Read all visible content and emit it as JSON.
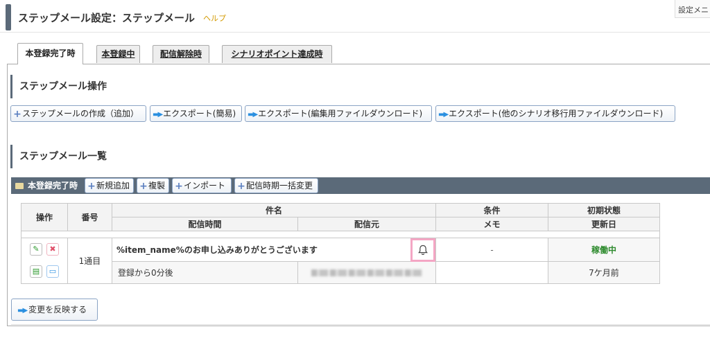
{
  "header": {
    "title": "ステップメール設定：ステップメール",
    "help": "ヘルプ",
    "settings_menu": "設定メニ"
  },
  "tabs": [
    {
      "label": "本登録完了時",
      "active": true
    },
    {
      "label": "本登録中",
      "active": false
    },
    {
      "label": "配信解除時",
      "active": false
    },
    {
      "label": "シナリオポイント達成時",
      "active": false
    }
  ],
  "operations": {
    "heading": "ステップメール操作",
    "buttons": [
      "ステップメールの作成（追加）",
      "エクスポート(簡易)",
      "エクスポート(編集用ファイルダウンロード)",
      "エクスポート(他のシナリオ移行用ファイルダウンロード)"
    ]
  },
  "list": {
    "heading": "ステップメール一覧",
    "bar_label": "本登録完了時",
    "bar_buttons": [
      "新規追加",
      "複製",
      "インポート",
      "配信時期一括変更"
    ],
    "columns": {
      "ops": "操作",
      "number": "番号",
      "subject": "件名",
      "send_time": "配信時間",
      "sender": "配信元",
      "condition": "条件",
      "memo": "メモ",
      "initial_state": "初期状態",
      "updated": "更新日"
    },
    "rows": [
      {
        "number": "1通目",
        "subject": "%item_name%のお申し込みありがとうございます",
        "condition": "-",
        "state": "稼働中",
        "send_time": "登録から0分後",
        "updated": "7ケ月前"
      }
    ]
  },
  "apply_button": "変更を反映する",
  "colors": {
    "accent_bar": "#5b6a79",
    "help_text": "#d39a00",
    "active_state": "#2e8b2e",
    "highlight_box": "#f4a6c4"
  }
}
